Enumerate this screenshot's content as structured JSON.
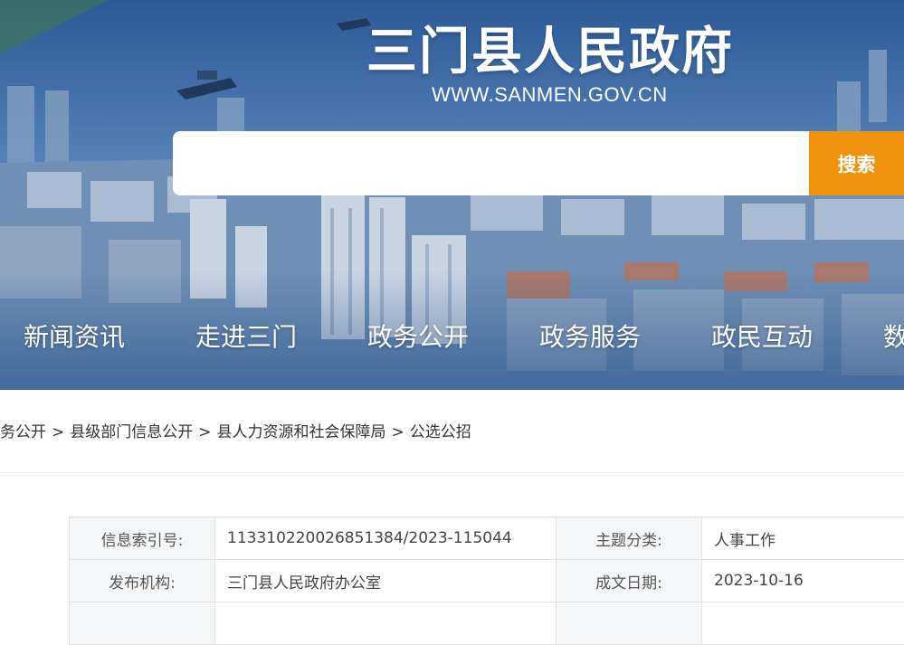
{
  "header": {
    "site_title": "三门县人民政府",
    "site_url": "WWW.SANMEN.GOV.CN"
  },
  "search": {
    "placeholder": "",
    "value": "",
    "button_label": "搜索",
    "button_color": "#f0920d"
  },
  "nav": {
    "items": [
      {
        "label": "新闻资讯"
      },
      {
        "label": "走进三门"
      },
      {
        "label": "政务公开"
      },
      {
        "label": "政务服务"
      },
      {
        "label": "政民互动"
      },
      {
        "label": "数"
      }
    ]
  },
  "breadcrumb": {
    "items": [
      "务公开",
      "县级部门信息公开",
      "县人力资源和社会保障局",
      "公选公招"
    ],
    "separator": ">"
  },
  "meta": {
    "rows": [
      {
        "label1": "信息索引号:",
        "value1": "11331022002685138‌4/2023-115044",
        "label2": "主题分类:",
        "value2": "人事工作"
      },
      {
        "label1": "发布机构:",
        "value1": "三门县人民政府办公室",
        "label2": "成文日期:",
        "value2": "2023-10-16"
      },
      {
        "label1": "",
        "value1": "",
        "label2": "",
        "value2": ""
      }
    ]
  },
  "colors": {
    "accent": "#f0920d",
    "banner_blue": "#4a7bb6",
    "table_label_bg": "#f5f6f8"
  }
}
